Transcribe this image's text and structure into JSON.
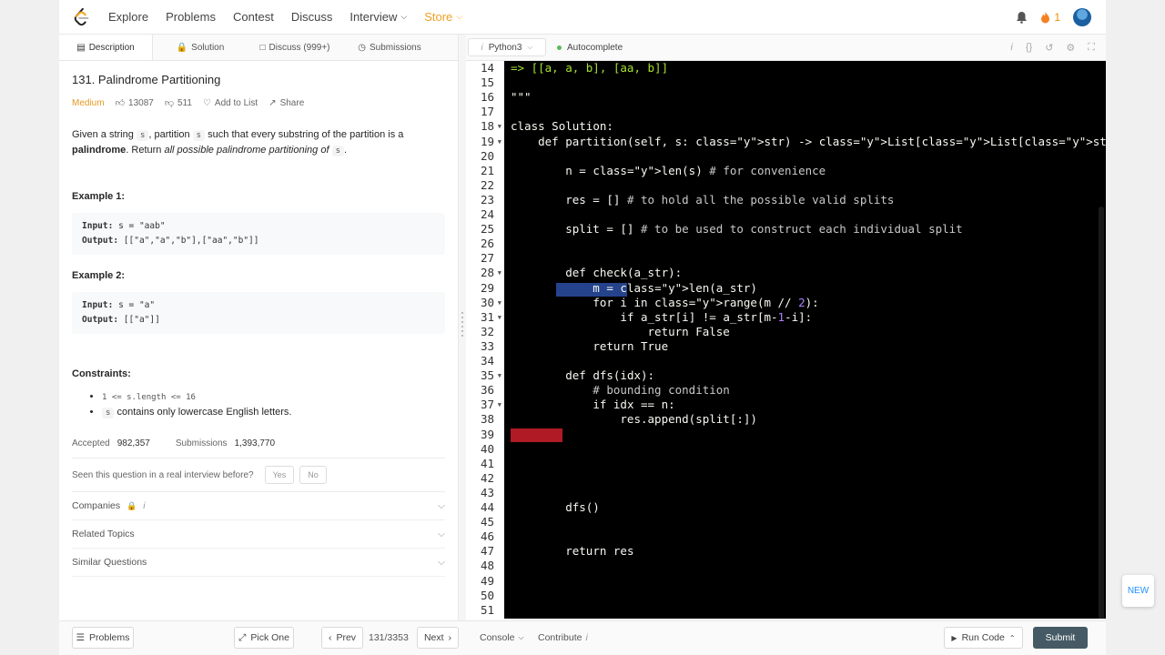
{
  "nav": {
    "items": [
      "Explore",
      "Problems",
      "Contest",
      "Discuss",
      "Interview",
      "Store"
    ],
    "notification_count": "1"
  },
  "tabs": {
    "description": "Description",
    "solution": "Solution",
    "discuss": "Discuss (999+)",
    "submissions": "Submissions"
  },
  "problem": {
    "title": "131. Palindrome Partitioning",
    "difficulty": "Medium",
    "likes": "13087",
    "dislikes": "511",
    "add_to_list": "Add to List",
    "share": "Share",
    "desc_1": "Given a string",
    "desc_s": "s",
    "desc_2": ", partition",
    "desc_3": "such that every substring of the partition is a",
    "desc_bold": "palindrome",
    "desc_4": ". Return",
    "desc_italic": "all possible palindrome partitioning of",
    "desc_5": ".",
    "example1_title": "Example 1:",
    "example1_input_label": "Input:",
    "example1_input": "s = \"aab\"",
    "example1_output_label": "Output:",
    "example1_output": "[[\"a\",\"a\",\"b\"],[\"aa\",\"b\"]]",
    "example2_title": "Example 2:",
    "example2_input_label": "Input:",
    "example2_input": "s = \"a\"",
    "example2_output_label": "Output:",
    "example2_output": "[[\"a\"]]",
    "constraints_title": "Constraints:",
    "constraint1": "1 <= s.length <= 16",
    "constraint2_code": "s",
    "constraint2_text": "contains only lowercase English letters.",
    "accepted_label": "Accepted",
    "accepted": "982,357",
    "submissions_label": "Submissions",
    "submissions": "1,393,770",
    "seen_question": "Seen this question in a real interview before?",
    "yes": "Yes",
    "no": "No",
    "companies": "Companies",
    "related_topics": "Related Topics",
    "similar_questions": "Similar Questions"
  },
  "editor": {
    "language": "Python3",
    "autocomplete": "Autocomplete",
    "line_numbers": [
      "14",
      "15",
      "16",
      "17",
      "18",
      "19",
      "20",
      "21",
      "22",
      "23",
      "24",
      "25",
      "26",
      "27",
      "28",
      "29",
      "30",
      "31",
      "32",
      "33",
      "34",
      "35",
      "36",
      "37",
      "38",
      "39",
      "40",
      "41",
      "42",
      "43",
      "44",
      "45",
      "46",
      "47",
      "48",
      "49",
      "50",
      "51"
    ],
    "folded_lines": [
      "18",
      "19",
      "28",
      "30",
      "31",
      "35",
      "37"
    ],
    "lines": [
      "=> [[a, a, b], [aa, b]]",
      "",
      "\"\"\"",
      "",
      "class Solution:",
      "    def partition(self, s: str) -> List[List[str]]:",
      "",
      "        n = len(s) # for convenience",
      "",
      "        res = [] # to hold all the possible valid splits",
      "",
      "        split = [] # to be used to construct each individual split",
      "",
      "",
      "        def check(a_str):",
      "            m = len(a_str)",
      "            for i in range(m // 2):",
      "                if a_str[i] != a_str[m-1-i]:",
      "                    return False",
      "            return True",
      "",
      "        def dfs(idx):",
      "            # bounding condition",
      "            if idx == n:",
      "                res.append(split[:])",
      "",
      "",
      "",
      "",
      "",
      "        dfs()",
      "",
      "",
      "        return res",
      "",
      "",
      "",
      ""
    ],
    "new_button": "NEW"
  },
  "bottom": {
    "problems": "Problems",
    "pick_one": "Pick One",
    "prev": "Prev",
    "page": "131/3353",
    "next": "Next",
    "console": "Console",
    "contribute": "Contribute",
    "run_code": "Run Code",
    "submit": "Submit"
  }
}
